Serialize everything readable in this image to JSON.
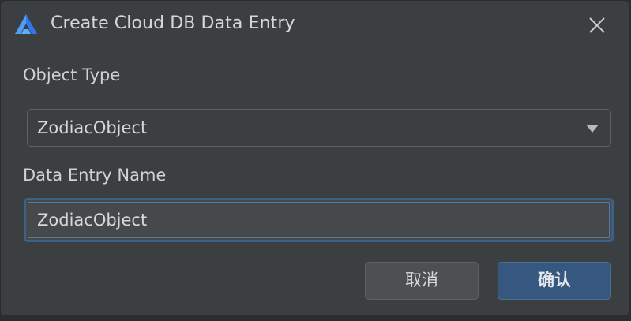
{
  "dialog": {
    "title": "Create Cloud DB Data Entry",
    "logo_icon": "huawei-devstudio-logo-icon",
    "close_icon": "close-icon"
  },
  "object_type": {
    "label": "Object Type",
    "selected": "ZodiacObject",
    "arrow_icon": "triangle-down-icon"
  },
  "data_entry_name": {
    "label": "Data Entry Name",
    "value": "ZodiacObject"
  },
  "buttons": {
    "cancel_label": "取消",
    "ok_label": "确认"
  },
  "colors": {
    "background": "#3c3f41",
    "accent": "#365880",
    "focus_border": "#3d6185",
    "text": "#d5d7da"
  }
}
